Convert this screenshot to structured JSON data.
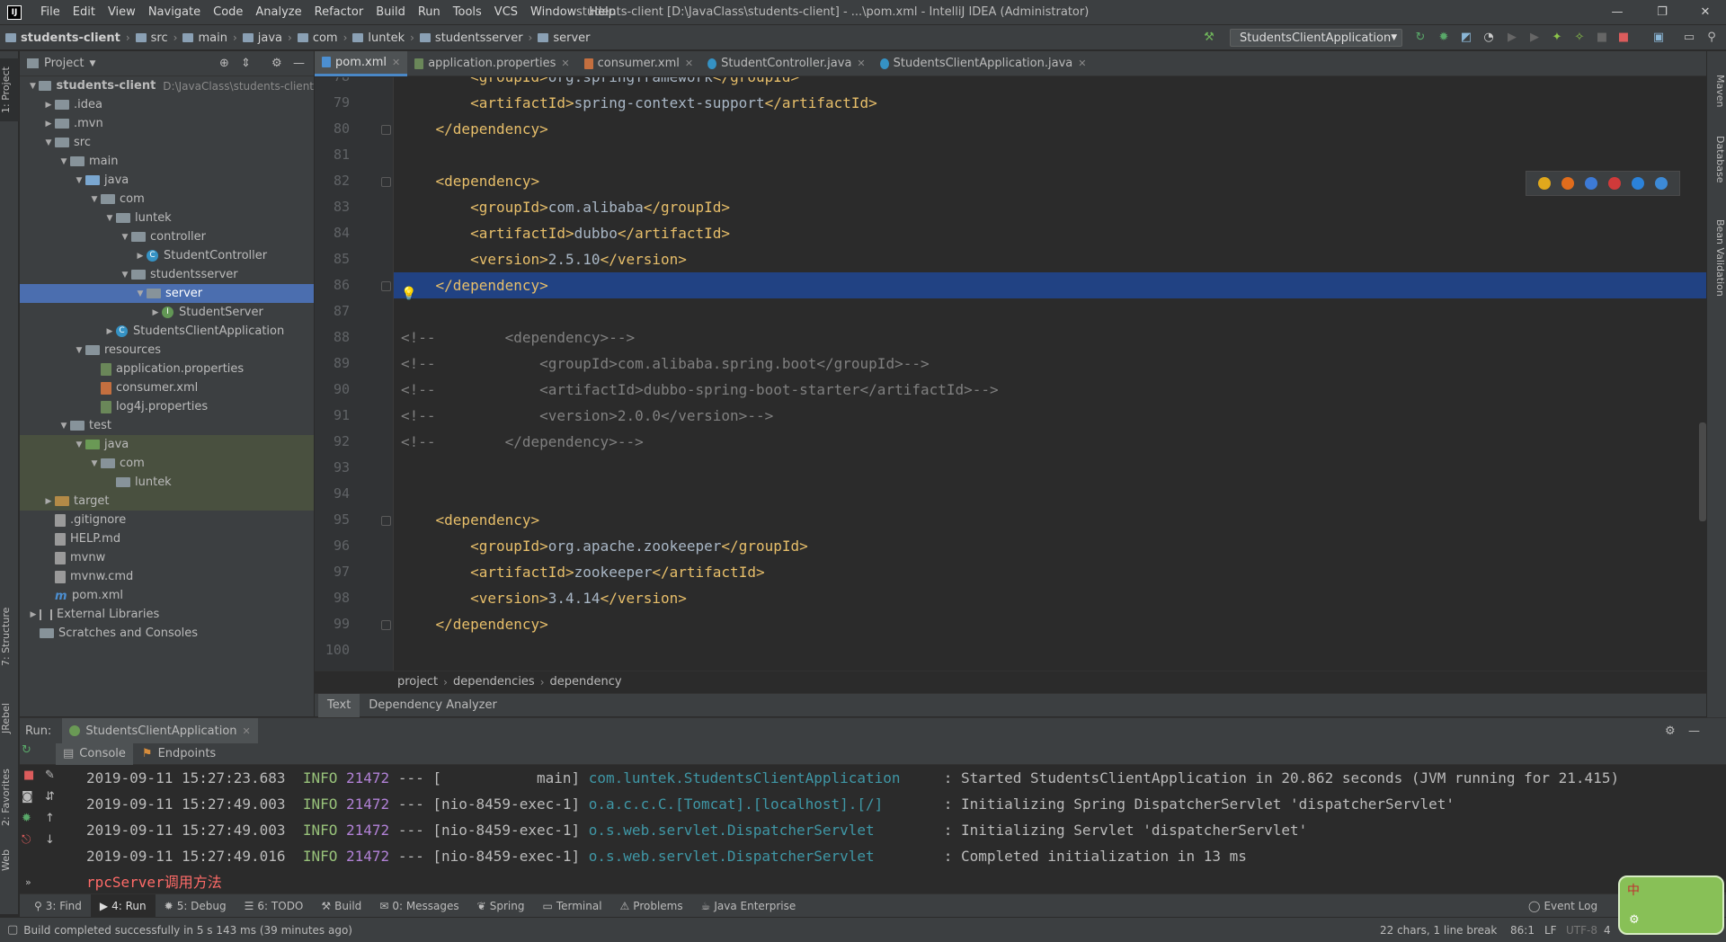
{
  "window": {
    "title": "students-client [D:\\JavaClass\\students-client] - ...\\pom.xml - IntelliJ IDEA (Administrator)",
    "logo": "IJ",
    "controls": [
      "—",
      "❐",
      "✕"
    ]
  },
  "menu": [
    "File",
    "Edit",
    "View",
    "Navigate",
    "Code",
    "Analyze",
    "Refactor",
    "Build",
    "Run",
    "Tools",
    "VCS",
    "Window",
    "Help"
  ],
  "breadcrumb": [
    "students-client",
    "src",
    "main",
    "java",
    "com",
    "luntek",
    "studentsserver",
    "server"
  ],
  "run_config": "StudentsClientApplication",
  "left_strip": {
    "project": "1: Project",
    "structure": "7: Structure",
    "jrebel": "JRebel",
    "favorites": "2: Favorites",
    "web": "Web"
  },
  "right_strip": {
    "maven": "Maven",
    "database": "Database",
    "bean_validation": "Bean Validation"
  },
  "project_panel": {
    "title": "Project",
    "tree": [
      {
        "label": "students-client",
        "hint": "D:\\JavaClass\\students-client",
        "depth": 0,
        "arrow": "▼",
        "icon": "folder"
      },
      {
        "label": ".idea",
        "depth": 1,
        "arrow": "▶",
        "icon": "folder"
      },
      {
        "label": ".mvn",
        "depth": 1,
        "arrow": "▶",
        "icon": "folder"
      },
      {
        "label": "src",
        "depth": 1,
        "arrow": "▼",
        "icon": "folder"
      },
      {
        "label": "main",
        "depth": 2,
        "arrow": "▼",
        "icon": "folder"
      },
      {
        "label": "java",
        "depth": 3,
        "arrow": "▼",
        "icon": "folder-blue"
      },
      {
        "label": "com",
        "depth": 4,
        "arrow": "▼",
        "icon": "package"
      },
      {
        "label": "luntek",
        "depth": 5,
        "arrow": "▼",
        "icon": "package"
      },
      {
        "label": "controller",
        "depth": 6,
        "arrow": "▼",
        "icon": "package"
      },
      {
        "label": "StudentController",
        "depth": 7,
        "arrow": "▶",
        "icon": "class"
      },
      {
        "label": "studentsserver",
        "depth": 6,
        "arrow": "▼",
        "icon": "package"
      },
      {
        "label": "server",
        "depth": 7,
        "arrow": "▼",
        "icon": "package",
        "selected": true
      },
      {
        "label": "StudentServer",
        "depth": 8,
        "arrow": "▶",
        "icon": "interface"
      },
      {
        "label": "StudentsClientApplication",
        "depth": 5,
        "arrow": "▶",
        "icon": "class"
      },
      {
        "label": "resources",
        "depth": 3,
        "arrow": "▼",
        "icon": "folder"
      },
      {
        "label": "application.properties",
        "depth": 4,
        "arrow": "",
        "icon": "prop"
      },
      {
        "label": "consumer.xml",
        "depth": 4,
        "arrow": "",
        "icon": "xml"
      },
      {
        "label": "log4j.properties",
        "depth": 4,
        "arrow": "",
        "icon": "prop"
      },
      {
        "label": "test",
        "depth": 2,
        "arrow": "▼",
        "icon": "folder"
      },
      {
        "label": "java",
        "depth": 3,
        "arrow": "▼",
        "icon": "folder-green",
        "test": true
      },
      {
        "label": "com",
        "depth": 4,
        "arrow": "▼",
        "icon": "package",
        "test": true
      },
      {
        "label": "luntek",
        "depth": 5,
        "arrow": "",
        "icon": "package",
        "test": true
      },
      {
        "label": "target",
        "depth": 1,
        "arrow": "▶",
        "icon": "folder-orange",
        "test": true
      },
      {
        "label": ".gitignore",
        "depth": 1,
        "arrow": "",
        "icon": "file"
      },
      {
        "label": "HELP.md",
        "depth": 1,
        "arrow": "",
        "icon": "file"
      },
      {
        "label": "mvnw",
        "depth": 1,
        "arrow": "",
        "icon": "file"
      },
      {
        "label": "mvnw.cmd",
        "depth": 1,
        "arrow": "",
        "icon": "file"
      },
      {
        "label": "pom.xml",
        "depth": 1,
        "arrow": "",
        "icon": "maven"
      },
      {
        "label": "External Libraries",
        "depth": 0,
        "arrow": "▶",
        "icon": "lib"
      },
      {
        "label": "Scratches and Consoles",
        "depth": 0,
        "arrow": "",
        "icon": "scratch"
      }
    ]
  },
  "tabs": [
    {
      "label": "pom.xml",
      "icon": "maven",
      "active": true
    },
    {
      "label": "application.properties",
      "icon": "prop"
    },
    {
      "label": "consumer.xml",
      "icon": "xml"
    },
    {
      "label": "StudentController.java",
      "icon": "class"
    },
    {
      "label": "StudentsClientApplication.java",
      "icon": "class"
    }
  ],
  "code": [
    {
      "n": 78,
      "text": "        <groupId>org.springframework</groupId>"
    },
    {
      "n": 79,
      "text": "        <artifactId>spring-context-support</artifactId>"
    },
    {
      "n": 80,
      "text": "    </dependency>"
    },
    {
      "n": 81,
      "text": ""
    },
    {
      "n": 82,
      "text": "    <dependency>"
    },
    {
      "n": 83,
      "text": "        <groupId>com.alibaba</groupId>"
    },
    {
      "n": 84,
      "text": "        <artifactId>dubbo</artifactId>"
    },
    {
      "n": 85,
      "text": "        <version>2.5.10</version>"
    },
    {
      "n": 86,
      "text": "    </dependency>",
      "highlight": true
    },
    {
      "n": 87,
      "text": ""
    },
    {
      "n": 88,
      "text": "<!--        <dependency>-->",
      "comment": true
    },
    {
      "n": 89,
      "text": "<!--            <groupId>com.alibaba.spring.boot</groupId>-->",
      "comment": true
    },
    {
      "n": 90,
      "text": "<!--            <artifactId>dubbo-spring-boot-starter</artifactId>-->",
      "comment": true
    },
    {
      "n": 91,
      "text": "<!--            <version>2.0.0</version>-->",
      "comment": true
    },
    {
      "n": 92,
      "text": "<!--        </dependency>-->",
      "comment": true
    },
    {
      "n": 93,
      "text": ""
    },
    {
      "n": 94,
      "text": ""
    },
    {
      "n": 95,
      "text": "    <dependency>"
    },
    {
      "n": 96,
      "text": "        <groupId>org.apache.zookeeper</groupId>"
    },
    {
      "n": 97,
      "text": "        <artifactId>zookeeper</artifactId>"
    },
    {
      "n": 98,
      "text": "        <version>3.4.14</version>"
    },
    {
      "n": 99,
      "text": "    </dependency>"
    },
    {
      "n": 100,
      "text": ""
    }
  ],
  "editor_breadcrumb": [
    "project",
    "dependencies",
    "dependency"
  ],
  "editor_bottom_tabs": [
    "Text",
    "Dependency Analyzer"
  ],
  "run": {
    "label": "Run:",
    "config": "StudentsClientApplication",
    "subtabs": [
      "Console",
      "Endpoints"
    ],
    "console": [
      {
        "ts": "2019-09-11 15:27:23.683",
        "level": "INFO",
        "pid": "21472",
        "sep": "---",
        "thread": "[           main]",
        "logger": "com.luntek.StudentsClientApplication    ",
        "msg": ": Started StudentsClientApplication in 20.862 seconds (JVM running for 21.415)"
      },
      {
        "ts": "2019-09-11 15:27:49.003",
        "level": "INFO",
        "pid": "21472",
        "sep": "---",
        "thread": "[nio-8459-exec-1]",
        "logger": "o.a.c.c.C.[Tomcat].[localhost].[/]      ",
        "msg": ": Initializing Spring DispatcherServlet 'dispatcherServlet'"
      },
      {
        "ts": "2019-09-11 15:27:49.003",
        "level": "INFO",
        "pid": "21472",
        "sep": "---",
        "thread": "[nio-8459-exec-1]",
        "logger": "o.s.web.servlet.DispatcherServlet       ",
        "msg": ": Initializing Servlet 'dispatcherServlet'"
      },
      {
        "ts": "2019-09-11 15:27:49.016",
        "level": "INFO",
        "pid": "21472",
        "sep": "---",
        "thread": "[nio-8459-exec-1]",
        "logger": "o.s.web.servlet.DispatcherServlet       ",
        "msg": ": Completed initialization in 13 ms"
      }
    ],
    "output_line": "rpcServer调用方法"
  },
  "tool_buttons": [
    {
      "label": "3: Find",
      "icon": "search"
    },
    {
      "label": "4: Run",
      "icon": "run",
      "active": true
    },
    {
      "label": "5: Debug",
      "icon": "debug"
    },
    {
      "label": "6: TODO",
      "icon": "todo"
    },
    {
      "label": "Build",
      "icon": "build"
    },
    {
      "label": "0: Messages",
      "icon": "messages"
    },
    {
      "label": "Spring",
      "icon": "spring"
    },
    {
      "label": "Terminal",
      "icon": "terminal"
    },
    {
      "label": "Problems",
      "icon": "problems"
    },
    {
      "label": "Java Enterprise",
      "icon": "javaee"
    }
  ],
  "event_log": "Event Log",
  "status": {
    "message": "Build completed successfully in 5 s 143 ms (39 minutes ago)",
    "chars": "22 chars, 1 line break",
    "position": "86:1",
    "line_sep": "LF",
    "encoding": "UTF-8",
    "indent": "4"
  },
  "widget_char": "中"
}
